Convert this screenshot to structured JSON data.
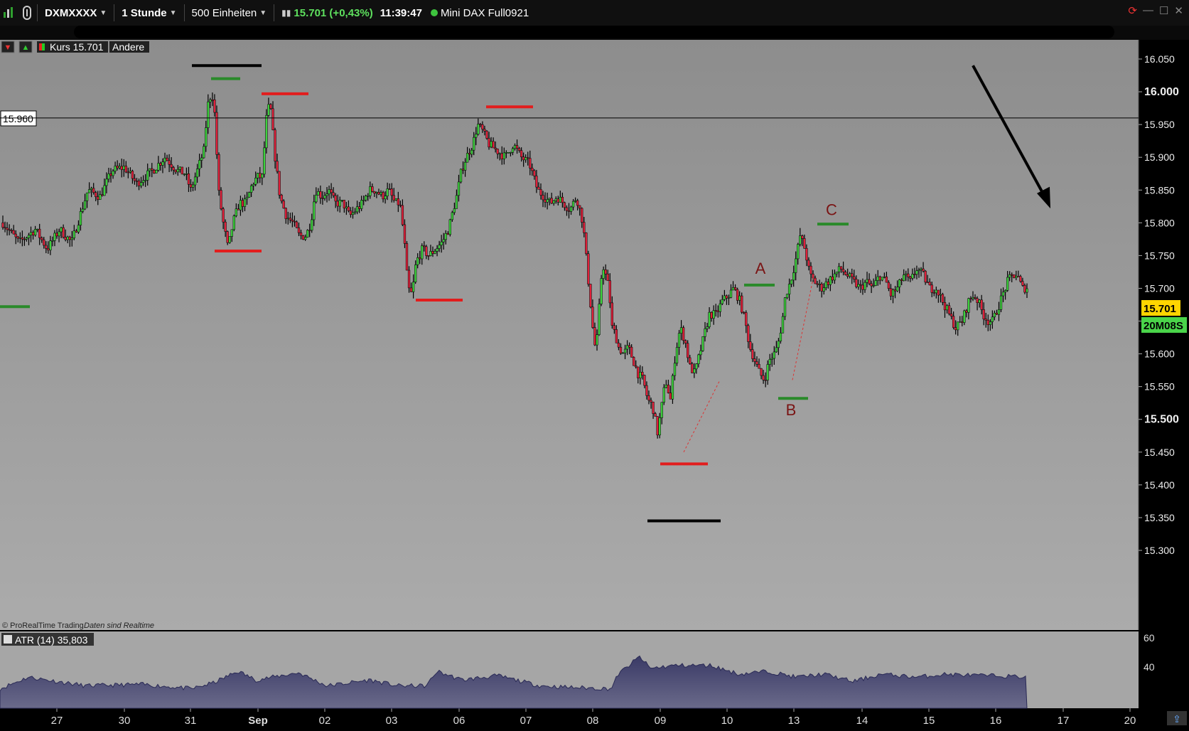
{
  "toolbar": {
    "symbol": "DXMXXXX",
    "timeframe": "1 Stunde",
    "units": "500 Einheiten",
    "price": "15.701 (+0,43%)",
    "time": "11:39:47",
    "instrument": "Mini DAX Full0921"
  },
  "legend": {
    "kurs": "Kurs 15.701",
    "andere": "Andere"
  },
  "watermark": {
    "brand": "© ProRealTime Trading",
    "note": "Daten sind Realtime"
  },
  "hline": {
    "value": 15960,
    "label": "15.960"
  },
  "last_price": {
    "label": "15.701",
    "countdown": "20M08S",
    "value": 15701
  },
  "waves": {
    "a": "A",
    "b": "B",
    "c": "C"
  },
  "atr": {
    "label": "ATR (14) 35,803",
    "ticks": [
      "60",
      "40"
    ]
  },
  "colors": {
    "up": "#3dd23d",
    "down": "#e0203a",
    "bg_top": "#8e8e8e",
    "bg_bottom": "#a9a9a9",
    "atr_fill": "#4a4a70"
  },
  "chart_data": {
    "type": "candlestick",
    "y_ticks": [
      "16.050",
      "16.000",
      "15.950",
      "15.900",
      "15.850",
      "15.800",
      "15.750",
      "15.700",
      "15.650",
      "15.600",
      "15.550",
      "15.500",
      "15.450",
      "15.400",
      "15.350",
      "15.300"
    ],
    "ylim": [
      15260,
      16080
    ],
    "x_ticks": [
      "27",
      "30",
      "31",
      "Sep",
      "02",
      "03",
      "06",
      "07",
      "08",
      "09",
      "10",
      "13",
      "14",
      "15",
      "16",
      "17",
      "20"
    ],
    "candles_bars": 475,
    "price_path": [
      [
        0,
        15800
      ],
      [
        20,
        15770
      ],
      [
        40,
        15790
      ],
      [
        55,
        15760
      ],
      [
        70,
        15790
      ],
      [
        85,
        15770
      ],
      [
        105,
        15850
      ],
      [
        120,
        15840
      ],
      [
        135,
        15880
      ],
      [
        150,
        15885
      ],
      [
        165,
        15860
      ],
      [
        175,
        15870
      ],
      [
        185,
        15880
      ],
      [
        200,
        15900
      ],
      [
        215,
        15880
      ],
      [
        225,
        15875
      ],
      [
        232,
        15850
      ],
      [
        240,
        15880
      ],
      [
        248,
        15910
      ],
      [
        253,
        15980
      ],
      [
        258,
        16000
      ],
      [
        262,
        15960
      ],
      [
        266,
        15850
      ],
      [
        272,
        15800
      ],
      [
        278,
        15760
      ],
      [
        284,
        15800
      ],
      [
        292,
        15830
      ],
      [
        300,
        15830
      ],
      [
        308,
        15860
      ],
      [
        314,
        15870
      ],
      [
        320,
        15870
      ],
      [
        326,
        15970
      ],
      [
        330,
        15980
      ],
      [
        336,
        15900
      ],
      [
        342,
        15840
      ],
      [
        350,
        15810
      ],
      [
        358,
        15800
      ],
      [
        366,
        15780
      ],
      [
        374,
        15780
      ],
      [
        380,
        15800
      ],
      [
        386,
        15850
      ],
      [
        394,
        15840
      ],
      [
        402,
        15850
      ],
      [
        410,
        15830
      ],
      [
        420,
        15830
      ],
      [
        428,
        15810
      ],
      [
        436,
        15820
      ],
      [
        444,
        15830
      ],
      [
        452,
        15850
      ],
      [
        460,
        15850
      ],
      [
        468,
        15840
      ],
      [
        476,
        15850
      ],
      [
        484,
        15830
      ],
      [
        490,
        15830
      ],
      [
        495,
        15780
      ],
      [
        500,
        15700
      ],
      [
        505,
        15690
      ],
      [
        510,
        15740
      ],
      [
        518,
        15760
      ],
      [
        526,
        15750
      ],
      [
        534,
        15760
      ],
      [
        542,
        15770
      ],
      [
        550,
        15790
      ],
      [
        560,
        15840
      ],
      [
        566,
        15880
      ],
      [
        572,
        15900
      ],
      [
        580,
        15920
      ],
      [
        586,
        15950
      ],
      [
        592,
        15940
      ],
      [
        600,
        15920
      ],
      [
        610,
        15910
      ],
      [
        620,
        15900
      ],
      [
        630,
        15920
      ],
      [
        640,
        15900
      ],
      [
        650,
        15890
      ],
      [
        660,
        15850
      ],
      [
        668,
        15840
      ],
      [
        676,
        15830
      ],
      [
        684,
        15840
      ],
      [
        692,
        15830
      ],
      [
        700,
        15820
      ],
      [
        708,
        15840
      ],
      [
        716,
        15800
      ],
      [
        722,
        15720
      ],
      [
        728,
        15640
      ],
      [
        732,
        15600
      ],
      [
        736,
        15670
      ],
      [
        740,
        15740
      ],
      [
        744,
        15720
      ],
      [
        748,
        15700
      ],
      [
        752,
        15640
      ],
      [
        756,
        15630
      ],
      [
        760,
        15610
      ],
      [
        766,
        15600
      ],
      [
        772,
        15610
      ],
      [
        778,
        15590
      ],
      [
        784,
        15570
      ],
      [
        790,
        15560
      ],
      [
        796,
        15530
      ],
      [
        802,
        15520
      ],
      [
        808,
        15480
      ],
      [
        812,
        15510
      ],
      [
        818,
        15560
      ],
      [
        824,
        15530
      ],
      [
        830,
        15600
      ],
      [
        836,
        15640
      ],
      [
        842,
        15620
      ],
      [
        848,
        15580
      ],
      [
        854,
        15570
      ],
      [
        860,
        15600
      ],
      [
        866,
        15630
      ],
      [
        872,
        15660
      ],
      [
        880,
        15660
      ],
      [
        888,
        15680
      ],
      [
        896,
        15690
      ],
      [
        902,
        15700
      ],
      [
        910,
        15680
      ],
      [
        916,
        15650
      ],
      [
        922,
        15610
      ],
      [
        928,
        15590
      ],
      [
        934,
        15570
      ],
      [
        940,
        15560
      ],
      [
        946,
        15590
      ],
      [
        952,
        15600
      ],
      [
        956,
        15610
      ],
      [
        962,
        15650
      ],
      [
        966,
        15690
      ],
      [
        972,
        15710
      ],
      [
        978,
        15740
      ],
      [
        984,
        15780
      ],
      [
        990,
        15760
      ],
      [
        996,
        15720
      ],
      [
        1002,
        15710
      ],
      [
        1010,
        15700
      ],
      [
        1018,
        15710
      ],
      [
        1026,
        15720
      ],
      [
        1034,
        15730
      ],
      [
        1042,
        15720
      ],
      [
        1050,
        15710
      ],
      [
        1058,
        15700
      ],
      [
        1066,
        15710
      ],
      [
        1074,
        15700
      ],
      [
        1082,
        15720
      ],
      [
        1090,
        15710
      ],
      [
        1096,
        15690
      ],
      [
        1104,
        15700
      ],
      [
        1112,
        15720
      ],
      [
        1120,
        15710
      ],
      [
        1128,
        15730
      ],
      [
        1136,
        15720
      ],
      [
        1144,
        15700
      ],
      [
        1152,
        15700
      ],
      [
        1160,
        15680
      ],
      [
        1168,
        15660
      ],
      [
        1176,
        15640
      ],
      [
        1184,
        15650
      ],
      [
        1192,
        15680
      ],
      [
        1198,
        15690
      ],
      [
        1204,
        15680
      ],
      [
        1210,
        15660
      ],
      [
        1216,
        15650
      ],
      [
        1222,
        15650
      ],
      [
        1228,
        15670
      ],
      [
        1234,
        15690
      ],
      [
        1240,
        15710
      ],
      [
        1246,
        15720
      ],
      [
        1252,
        15720
      ],
      [
        1258,
        15700
      ],
      [
        1264,
        15701
      ]
    ]
  }
}
